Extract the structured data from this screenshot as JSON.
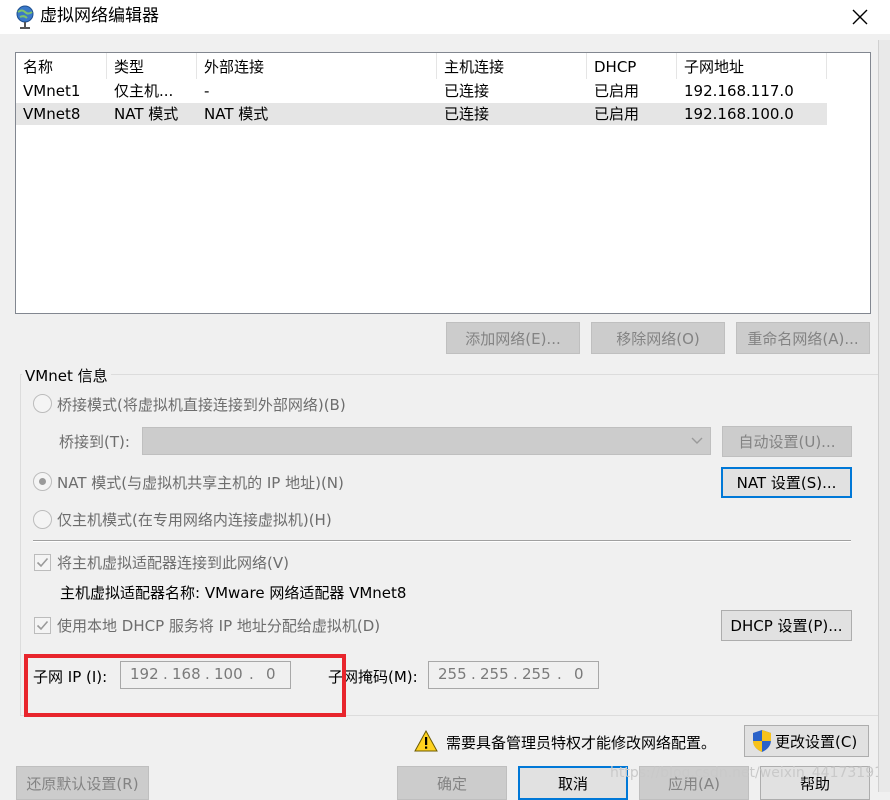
{
  "window": {
    "title": "虚拟网络编辑器"
  },
  "table": {
    "headers": [
      "名称",
      "类型",
      "外部连接",
      "主机连接",
      "DHCP",
      "子网地址"
    ],
    "rows": [
      [
        "VMnet1",
        "仅主机...",
        "-",
        "已连接",
        "已启用",
        "192.168.117.0"
      ],
      [
        "VMnet8",
        "NAT 模式",
        "NAT 模式",
        "已连接",
        "已启用",
        "192.168.100.0"
      ]
    ]
  },
  "network_buttons": {
    "add": "添加网络(E)...",
    "remove": "移除网络(O)",
    "rename": "重命名网络(A)..."
  },
  "vmnet_info": {
    "title": "VMnet 信息",
    "bridged_label": "桥接模式(将虚拟机直接连接到外部网络)(B)",
    "bridge_to_label": "桥接到(T):",
    "bridge_to_value": "",
    "auto_settings": "自动设置(U)...",
    "nat_label": "NAT 模式(与虚拟机共享主机的 IP 地址)(N)",
    "nat_settings": "NAT 设置(S)...",
    "hostonly_label": "仅主机模式(在专用网络内连接虚拟机)(H)",
    "connect_adapter_label": "将主机虚拟适配器连接到此网络(V)",
    "adapter_name_text": "主机虚拟适配器名称: VMware 网络适配器 VMnet8",
    "dhcp_label": "使用本地 DHCP 服务将 IP 地址分配给虚拟机(D)",
    "dhcp_settings": "DHCP 设置(P)...",
    "subnet_ip_label": "子网 IP (I):",
    "subnet_ip": [
      "192",
      "168",
      "100",
      "0"
    ],
    "subnet_mask_label": "子网掩码(M):",
    "subnet_mask": [
      "255",
      "255",
      "255",
      "0"
    ],
    "selected_mode": "nat",
    "connect_adapter_checked": true,
    "dhcp_checked": true
  },
  "admin": {
    "warning_text": "需要具备管理员特权才能修改网络配置。",
    "change_settings": "更改设置(C)"
  },
  "footer": {
    "restore_defaults": "还原默认设置(R)",
    "ok": "确定",
    "cancel": "取消",
    "apply": "应用(A)",
    "help": "帮助"
  },
  "watermark": "https://blog.csdn.net/weixin_44173191",
  "colors": {
    "highlight_box": "#e8252c",
    "focus_border": "#0078d7",
    "selected_row": "#e5e5e5"
  },
  "icons": {
    "title": "globe-network-icon",
    "close": "close-icon",
    "warning": "warning-icon",
    "shield": "uac-shield-icon"
  }
}
